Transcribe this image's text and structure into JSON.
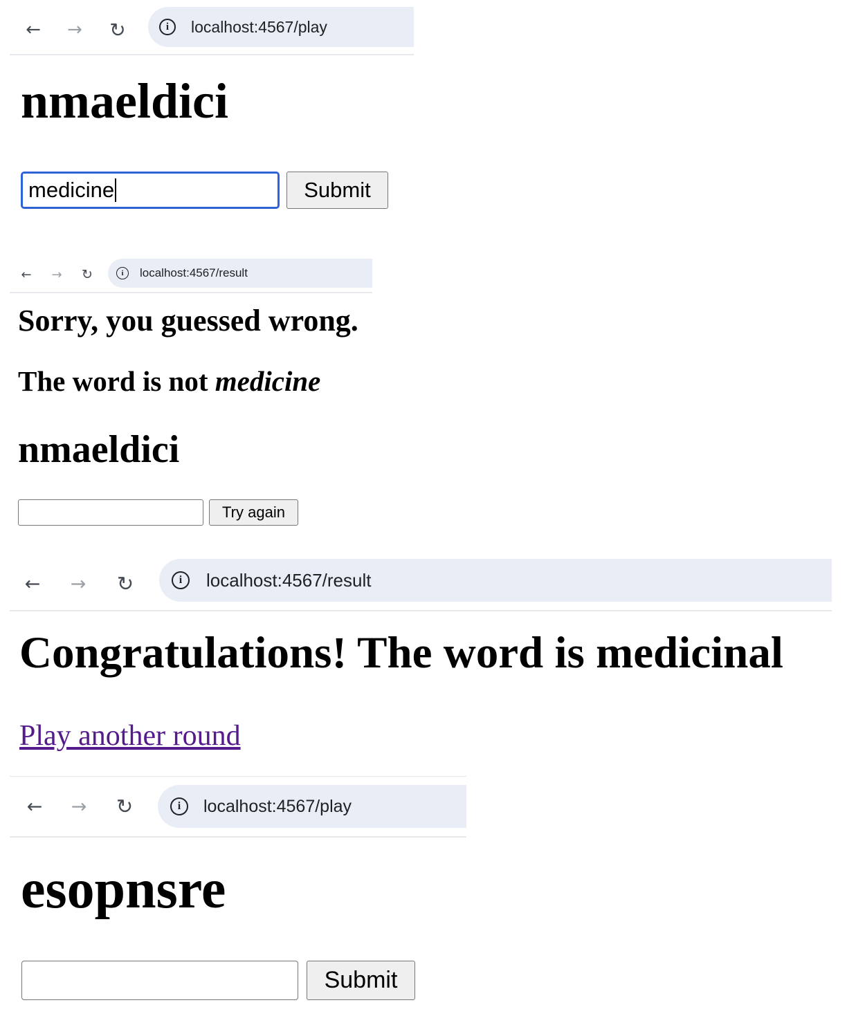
{
  "nav": {
    "back": "←",
    "forward": "→",
    "reload": "↻",
    "info": "i"
  },
  "screen1": {
    "url": "localhost:4567/play",
    "scrambled_word": "nmaeldici",
    "guess_value": "medicine",
    "submit_label": "Submit"
  },
  "screen2": {
    "url": "localhost:4567/result",
    "message": "Sorry, you guessed wrong.",
    "not_prefix": "The word is not ",
    "not_word": "medicine",
    "scrambled_word": "nmaeldici",
    "guess_value": "",
    "try_again_label": "Try again"
  },
  "screen3": {
    "url": "localhost:4567/result",
    "message": "Congratulations! The word is medicinal",
    "play_again_label": "Play another round"
  },
  "screen4": {
    "url": "localhost:4567/play",
    "scrambled_word": "esopnsre",
    "guess_value": "",
    "submit_label": "Submit"
  },
  "colors": {
    "url_bar_bg": "#e9edf6",
    "focus_ring": "#2f62d6",
    "visited_link": "#551a8b"
  }
}
